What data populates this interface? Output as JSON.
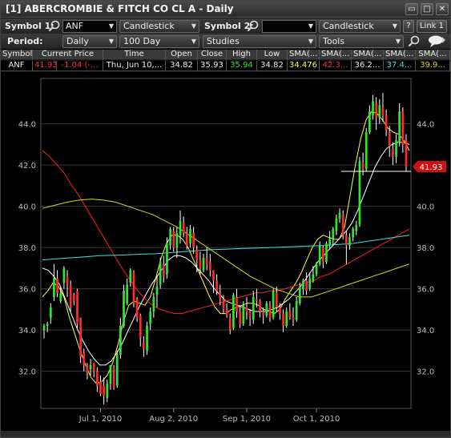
{
  "window": {
    "title": "[1] ABERCROMBIE & FITCH CO CL A - Daily",
    "buttons": {
      "restore": "▭",
      "maximize": "□",
      "close": "✕"
    }
  },
  "toolbar1": {
    "symbol1_label": "Symbol 1:",
    "symbol1_value": "ANF",
    "chart_type1": "Candlestick",
    "symbol2_label": "Symbol 2:",
    "symbol2_value": "",
    "chart_type2": "Candlestick",
    "help_label": "?",
    "link_label": "Link 1"
  },
  "toolbar2": {
    "period_label": "Period:",
    "period_value": "Daily",
    "range_value": "100 Day",
    "studies_value": "Studies",
    "tools_value": "Tools"
  },
  "quote": {
    "headers": [
      "Symbol",
      "Current Price",
      "Time",
      "Open",
      "Close",
      "High",
      "Low",
      "SMA(...",
      "SMA(...",
      "SMA(...",
      "SMA(...",
      "SMA(..."
    ],
    "values": [
      "ANF",
      "41.93",
      "-1.04 (-...",
      "Thu, Jun 10,...",
      "34.82",
      "35.93",
      "35.94",
      "34.82",
      "34.476",
      "42.3...",
      "36.2...",
      "37.4...",
      "39.9..."
    ]
  },
  "colors": {
    "up": "#2ee82e",
    "down": "#ff2a2a",
    "sma_fast": "#ffff40",
    "sma_white": "#ffffff",
    "sma_red": "#ff2020",
    "sma_cyan": "#40e0e0",
    "sma_olive": "#d8d820",
    "grid": "#3a3a3a",
    "price_tag": "#cc1010"
  },
  "chart_data": {
    "type": "candlestick",
    "ylim": [
      30.2,
      46.2
    ],
    "yticks": [
      "44.0",
      "42.0",
      "40.0",
      "38.0",
      "36.0",
      "34.0",
      "32.0"
    ],
    "xticks": [
      "Jul 1, 2010",
      "Aug 2, 2010",
      "Sep 1, 2010",
      "Oct 1, 2010"
    ],
    "last_price_label": "41.93",
    "last_price": 41.93,
    "candles": [
      [
        34.0,
        34.2,
        33.6,
        34.3
      ],
      [
        34.2,
        34.3,
        33.9,
        34.4
      ],
      [
        34.6,
        35.1,
        34.3,
        35.3
      ],
      [
        35.6,
        36.5,
        35.4,
        37.2
      ],
      [
        36.5,
        35.8,
        35.6,
        36.9
      ],
      [
        35.4,
        35.8,
        35.3,
        36.1
      ],
      [
        36.3,
        37.0,
        36.0,
        37.1
      ],
      [
        36.6,
        36.2,
        35.6,
        36.9
      ],
      [
        36.2,
        35.1,
        34.9,
        36.4
      ],
      [
        35.7,
        35.4,
        35.2,
        35.8
      ],
      [
        35.9,
        34.3,
        34.1,
        36.0
      ],
      [
        34.6,
        32.7,
        32.4,
        34.6
      ],
      [
        32.9,
        32.3,
        32.0,
        33.1
      ],
      [
        32.3,
        31.9,
        31.6,
        32.4
      ],
      [
        32.1,
        32.3,
        31.8,
        32.6
      ],
      [
        32.4,
        32.0,
        31.7,
        32.4
      ],
      [
        32.0,
        31.3,
        31.0,
        32.2
      ],
      [
        31.5,
        30.9,
        30.8,
        31.8
      ],
      [
        31.3,
        30.8,
        30.4,
        31.7
      ],
      [
        30.7,
        31.4,
        30.5,
        31.6
      ],
      [
        31.4,
        32.3,
        31.1,
        32.3
      ],
      [
        32.2,
        31.2,
        31.1,
        32.3
      ],
      [
        31.3,
        32.8,
        31.2,
        33.0
      ],
      [
        32.8,
        34.2,
        32.6,
        34.6
      ],
      [
        34.2,
        35.9,
        34.1,
        36.2
      ],
      [
        35.3,
        36.2,
        35.2,
        36.5
      ],
      [
        36.3,
        36.9,
        36.1,
        37.0
      ],
      [
        36.8,
        35.3,
        35.1,
        36.9
      ],
      [
        35.5,
        34.6,
        34.4,
        35.6
      ],
      [
        34.7,
        33.6,
        33.2,
        34.8
      ],
      [
        33.4,
        33.1,
        32.7,
        33.7
      ],
      [
        33.0,
        34.2,
        32.8,
        34.4
      ],
      [
        34.3,
        34.9,
        34.0,
        35.1
      ],
      [
        34.9,
        35.6,
        34.6,
        35.8
      ],
      [
        35.7,
        36.1,
        35.1,
        36.6
      ],
      [
        36.2,
        37.3,
        36.0,
        37.5
      ],
      [
        37.2,
        36.6,
        36.3,
        37.6
      ],
      [
        36.7,
        38.2,
        36.5,
        38.5
      ],
      [
        38.1,
        38.9,
        37.9,
        39.0
      ],
      [
        38.8,
        38.0,
        37.8,
        39.0
      ],
      [
        38.0,
        38.7,
        37.5,
        39.0
      ],
      [
        38.6,
        39.3,
        38.2,
        39.8
      ],
      [
        39.2,
        38.7,
        38.5,
        39.5
      ],
      [
        38.7,
        38.1,
        37.9,
        39.0
      ],
      [
        38.2,
        38.9,
        38.0,
        39.1
      ],
      [
        38.7,
        38.0,
        37.7,
        39.0
      ],
      [
        37.9,
        37.4,
        36.8,
        38.1
      ],
      [
        37.4,
        37.0,
        36.7,
        37.8
      ],
      [
        36.9,
        37.5,
        36.8,
        37.7
      ],
      [
        37.5,
        37.2,
        36.9,
        38.0
      ],
      [
        37.3,
        36.9,
        36.6,
        37.7
      ],
      [
        36.9,
        36.4,
        35.8,
        36.9
      ],
      [
        36.4,
        35.9,
        35.7,
        36.7
      ],
      [
        35.8,
        35.5,
        35.2,
        36.2
      ],
      [
        35.5,
        35.0,
        34.8,
        35.7
      ],
      [
        35.0,
        34.7,
        34.6,
        35.3
      ],
      [
        34.6,
        34.0,
        33.8,
        34.8
      ],
      [
        34.1,
        35.7,
        34.0,
        35.8
      ],
      [
        35.6,
        34.9,
        34.6,
        36.0
      ],
      [
        34.9,
        34.3,
        34.1,
        35.2
      ],
      [
        34.3,
        35.2,
        34.2,
        35.4
      ],
      [
        35.1,
        34.9,
        34.5,
        35.6
      ],
      [
        34.9,
        34.6,
        34.2,
        35.0
      ],
      [
        34.5,
        35.6,
        34.3,
        35.9
      ],
      [
        35.5,
        35.4,
        35.1,
        36.0
      ],
      [
        35.4,
        34.9,
        34.6,
        35.5
      ],
      [
        34.9,
        34.7,
        34.3,
        35.1
      ],
      [
        34.7,
        35.3,
        34.6,
        35.4
      ],
      [
        35.2,
        34.6,
        34.4,
        35.4
      ],
      [
        34.6,
        35.9,
        34.5,
        36.0
      ],
      [
        35.8,
        35.1,
        34.9,
        36.1
      ],
      [
        35.1,
        34.8,
        34.5,
        35.3
      ],
      [
        34.8,
        34.2,
        33.9,
        35.0
      ],
      [
        34.2,
        34.9,
        34.1,
        35.1
      ],
      [
        34.9,
        34.6,
        34.5,
        35.3
      ],
      [
        34.6,
        34.5,
        34.2,
        35.1
      ],
      [
        34.5,
        35.4,
        34.4,
        35.6
      ],
      [
        35.3,
        36.1,
        35.2,
        36.3
      ],
      [
        36.0,
        36.4,
        35.7,
        36.5
      ],
      [
        36.4,
        35.9,
        35.7,
        36.8
      ],
      [
        36.0,
        36.5,
        35.9,
        36.8
      ],
      [
        36.4,
        36.7,
        36.3,
        37.1
      ],
      [
        36.7,
        37.2,
        36.6,
        37.3
      ],
      [
        37.2,
        38.1,
        37.1,
        38.3
      ],
      [
        38.0,
        37.3,
        37.0,
        38.1
      ],
      [
        37.3,
        38.2,
        37.2,
        38.3
      ],
      [
        38.1,
        38.4,
        37.9,
        38.8
      ],
      [
        38.4,
        38.9,
        38.1,
        39.0
      ],
      [
        38.8,
        39.4,
        38.6,
        39.6
      ],
      [
        39.4,
        39.7,
        39.2,
        39.9
      ],
      [
        39.6,
        38.6,
        38.4,
        39.8
      ],
      [
        38.6,
        38.1,
        37.2,
        38.8
      ],
      [
        38.1,
        38.5,
        37.9,
        38.7
      ],
      [
        38.5,
        38.9,
        38.3,
        39.0
      ],
      [
        38.8,
        39.1,
        38.6,
        39.3
      ],
      [
        39.1,
        42.2,
        39.0,
        42.4
      ],
      [
        42.1,
        41.8,
        41.5,
        42.6
      ],
      [
        41.8,
        43.6,
        41.7,
        43.8
      ],
      [
        43.6,
        44.6,
        43.5,
        44.9
      ],
      [
        44.4,
        45.1,
        44.2,
        45.4
      ],
      [
        45.0,
        44.3,
        43.7,
        45.3
      ],
      [
        44.3,
        44.9,
        44.0,
        45.2
      ],
      [
        44.8,
        44.4,
        44.1,
        45.5
      ],
      [
        44.4,
        43.7,
        43.4,
        44.7
      ],
      [
        43.6,
        42.9,
        42.4,
        43.9
      ],
      [
        42.8,
        42.4,
        42.0,
        43.1
      ],
      [
        42.4,
        43.2,
        42.1,
        43.5
      ],
      [
        43.1,
        44.6,
        42.9,
        45.0
      ],
      [
        44.6,
        43.0,
        42.6,
        44.8
      ],
      [
        43.2,
        41.9,
        41.7,
        43.5
      ]
    ],
    "sma_series": [
      {
        "color": "#ffff40",
        "values": [
          35.6,
          35.9,
          36.3,
          36.1,
          35.6,
          34.6,
          33.8,
          33.0,
          32.3,
          31.7,
          31.4,
          31.5,
          31.8,
          32.4,
          33.3,
          34.4,
          35.2,
          35.4,
          35.3,
          35.2,
          35.6,
          36.5,
          37.5,
          38.2,
          38.6,
          38.6,
          38.4,
          38.0,
          37.4,
          36.8,
          36.2,
          35.6,
          35.1,
          34.8,
          34.8,
          35.0,
          35.1,
          35.2,
          35.3,
          35.3,
          35.2,
          35.0,
          34.9,
          34.8,
          35.0,
          35.5,
          35.9,
          36.3,
          36.8,
          37.4,
          38.0,
          38.4,
          38.6,
          38.5,
          38.4,
          38.4,
          39.0,
          40.5,
          42.0,
          43.3,
          44.2,
          44.6,
          44.5,
          44.2,
          43.8,
          43.6,
          43.5,
          43.2,
          42.7
        ]
      },
      {
        "color": "#ffffff",
        "values": [
          37.0,
          36.9,
          36.6,
          36.2,
          35.5,
          34.8,
          34.1,
          33.5,
          33.0,
          32.6,
          32.3,
          32.3,
          32.5,
          32.9,
          33.4,
          34.0,
          34.6,
          35.2,
          35.7,
          36.2,
          36.6,
          37.0,
          37.4,
          37.6,
          37.6,
          37.5,
          37.3,
          37.0,
          36.7,
          36.4,
          36.0,
          35.7,
          35.4,
          35.3,
          35.2,
          35.1,
          35.0,
          34.9,
          34.9,
          34.9,
          35.0,
          35.1,
          35.3,
          35.5,
          35.8,
          36.1,
          36.5,
          36.9,
          37.3,
          37.6,
          37.9,
          38.2,
          38.5,
          38.8,
          39.2,
          39.8,
          40.5,
          41.2,
          41.9,
          42.4,
          42.8,
          43.0,
          43.1,
          43.1,
          43.0
        ]
      },
      {
        "color": "#ff2020",
        "values": [
          42.7,
          42.4,
          42.0,
          41.6,
          41.0,
          40.5,
          39.9,
          39.3,
          38.7,
          38.1,
          37.5,
          36.9,
          36.4,
          35.9,
          35.5,
          35.2,
          35.0,
          34.9,
          34.8,
          34.8,
          34.9,
          35.0,
          35.1,
          35.2,
          35.3,
          35.4,
          35.5,
          35.6,
          35.7,
          35.8,
          35.8,
          35.9,
          35.9,
          36.0,
          36.1,
          36.2,
          36.3,
          36.4,
          36.6,
          36.7,
          36.9,
          37.1,
          37.3,
          37.5,
          37.7,
          37.9,
          38.1,
          38.3,
          38.5,
          38.7,
          38.9
        ]
      },
      {
        "color": "#40e0e0",
        "values": [
          37.4,
          37.45,
          37.5,
          37.55,
          37.6,
          37.62,
          37.65,
          37.68,
          37.7,
          37.75,
          37.8,
          37.85,
          37.9,
          37.92,
          37.95,
          37.97,
          38.0,
          38.02,
          38.05,
          38.08,
          38.1,
          38.15,
          38.2,
          38.3,
          38.4,
          38.5,
          38.6
        ]
      },
      {
        "color": "#d8d820",
        "values": [
          39.9,
          40.05,
          40.2,
          40.3,
          40.35,
          40.3,
          40.2,
          40.0,
          39.8,
          39.6,
          39.3,
          39.0,
          38.6,
          38.2,
          37.8,
          37.4,
          37.0,
          36.6,
          36.3,
          36.0,
          35.8,
          35.6,
          35.6,
          35.8,
          36.0,
          36.2,
          36.4,
          36.6,
          36.8,
          37.0,
          37.2
        ]
      }
    ]
  }
}
